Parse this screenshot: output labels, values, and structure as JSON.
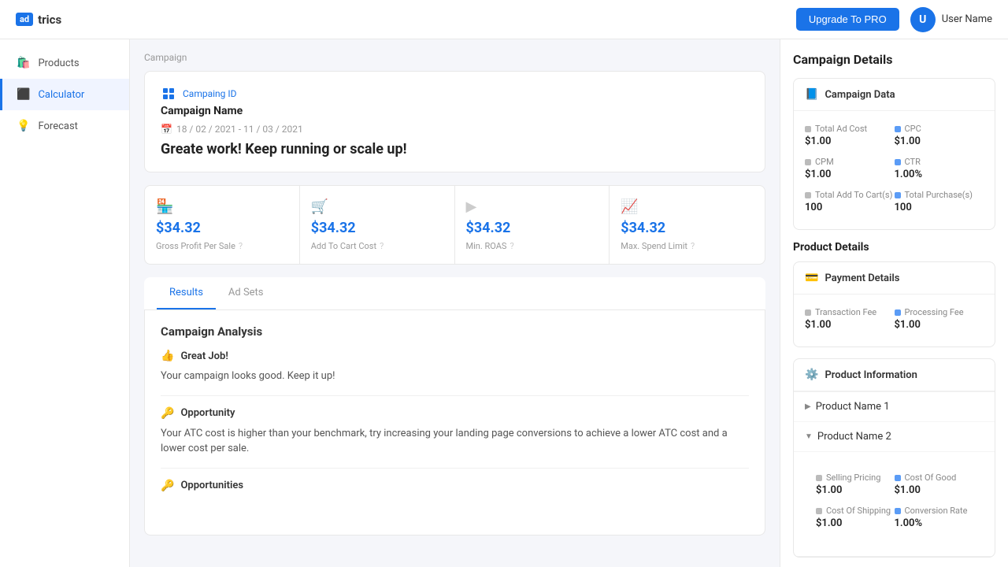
{
  "app": {
    "logo_badge": "ad",
    "logo_text": "trics",
    "upgrade_btn": "Upgrade To PRO",
    "user_avatar": "U",
    "user_name": "User Name"
  },
  "sidebar": {
    "items": [
      {
        "id": "products",
        "label": "Products",
        "icon": "🛍️",
        "active": false
      },
      {
        "id": "calculator",
        "label": "Calculator",
        "icon": "🖩",
        "active": true
      },
      {
        "id": "forecast",
        "label": "Forecast",
        "icon": "💡",
        "active": false
      }
    ]
  },
  "campaign": {
    "label": "Campaign",
    "id_label": "Campaing ID",
    "name": "Campaign Name",
    "date_start": "18 / 02 / 2021",
    "date_end": "11 / 03 / 2021",
    "headline": "Greate work! Keep running or scale up!"
  },
  "stats": [
    {
      "icon": "🏪",
      "value": "$34.32",
      "label": "Gross Profit Per Sale"
    },
    {
      "icon": "🛒",
      "value": "$34.32",
      "label": "Add To Cart Cost"
    },
    {
      "icon": "▶",
      "value": "$34.32",
      "label": "Min. ROAS"
    },
    {
      "icon": "📈",
      "value": "$34.32",
      "label": "Max. Spend Limit"
    }
  ],
  "tabs": [
    {
      "label": "Results",
      "active": true
    },
    {
      "label": "Ad Sets",
      "active": false
    }
  ],
  "analysis": {
    "title": "Campaign Analysis",
    "sections": [
      {
        "icon": "👍",
        "icon_color": "green",
        "title": "Great Job!",
        "text": "Your campaign looks good. Keep it up!"
      },
      {
        "icon": "🔑",
        "icon_color": "blue",
        "title": "Opportunity",
        "text": "Your ATC cost is higher than your benchmark, try increasing your landing page conversions to achieve a lower ATC cost and a lower cost per sale."
      },
      {
        "icon": "🔑",
        "icon_color": "blue",
        "title": "Opportunities",
        "text": ""
      }
    ]
  },
  "right_panel": {
    "title": "Campaign Details",
    "campaign_data": {
      "section_title": "Campaign Data",
      "metrics": [
        {
          "label": "Total Ad Cost",
          "value": "$1.00",
          "dot_color": "#bbb"
        },
        {
          "label": "CPC",
          "value": "$1.00",
          "dot_color": "#5b9cf6"
        },
        {
          "label": "CPM",
          "value": "$1.00",
          "dot_color": "#bbb"
        },
        {
          "label": "CTR",
          "value": "1.00%",
          "dot_color": "#5b9cf6"
        },
        {
          "label": "Total Add To Cart(s)",
          "value": "100",
          "dot_color": "#bbb"
        },
        {
          "label": "Total Purchase(s)",
          "value": "100",
          "dot_color": "#5b9cf6"
        }
      ]
    },
    "product_details_title": "Product Details",
    "payment_details": {
      "section_title": "Payment Details",
      "metrics": [
        {
          "label": "Transaction Fee",
          "value": "$1.00",
          "dot_color": "#bbb"
        },
        {
          "label": "Processing Fee",
          "value": "$1.00",
          "dot_color": "#5b9cf6"
        }
      ]
    },
    "product_information": {
      "section_title": "Product Information",
      "products": [
        {
          "name": "Product Name 1",
          "expanded": false,
          "icon": "▶"
        },
        {
          "name": "Product Name 2",
          "expanded": true,
          "icon": "▼"
        }
      ],
      "expanded_metrics": [
        {
          "label": "Selling Pricing",
          "value": "$1.00",
          "dot_color": "#bbb"
        },
        {
          "label": "Cost Of Good",
          "value": "$1.00",
          "dot_color": "#5b9cf6"
        },
        {
          "label": "Cost Of Shipping",
          "value": "$1.00",
          "dot_color": "#bbb"
        },
        {
          "label": "Conversion Rate",
          "value": "1.00%",
          "dot_color": "#5b9cf6"
        }
      ]
    }
  }
}
